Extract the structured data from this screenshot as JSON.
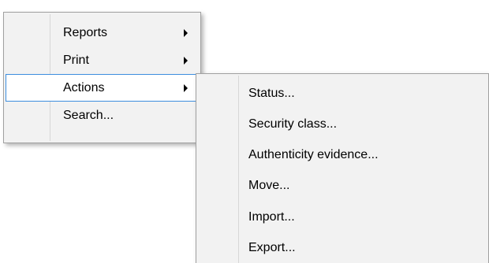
{
  "context_menu": {
    "items": [
      {
        "label": "Reports",
        "has_submenu": true,
        "highlighted": false
      },
      {
        "label": "Print",
        "has_submenu": true,
        "highlighted": false
      },
      {
        "label": "Actions",
        "has_submenu": true,
        "highlighted": true
      },
      {
        "label": "Search...",
        "has_submenu": false,
        "highlighted": false
      }
    ]
  },
  "actions_submenu": {
    "items": [
      {
        "label": "Status..."
      },
      {
        "label": "Security class..."
      },
      {
        "label": "Authenticity evidence..."
      },
      {
        "label": "Move..."
      },
      {
        "label": "Import..."
      },
      {
        "label": "Export..."
      }
    ]
  },
  "colors": {
    "menu_background": "#f2f2f2",
    "menu_border": "#a0a0a0",
    "highlight_border": "#3d8ede",
    "highlight_background": "#ffffff"
  },
  "icons": {
    "submenu_arrow": "chevron-right-icon"
  }
}
